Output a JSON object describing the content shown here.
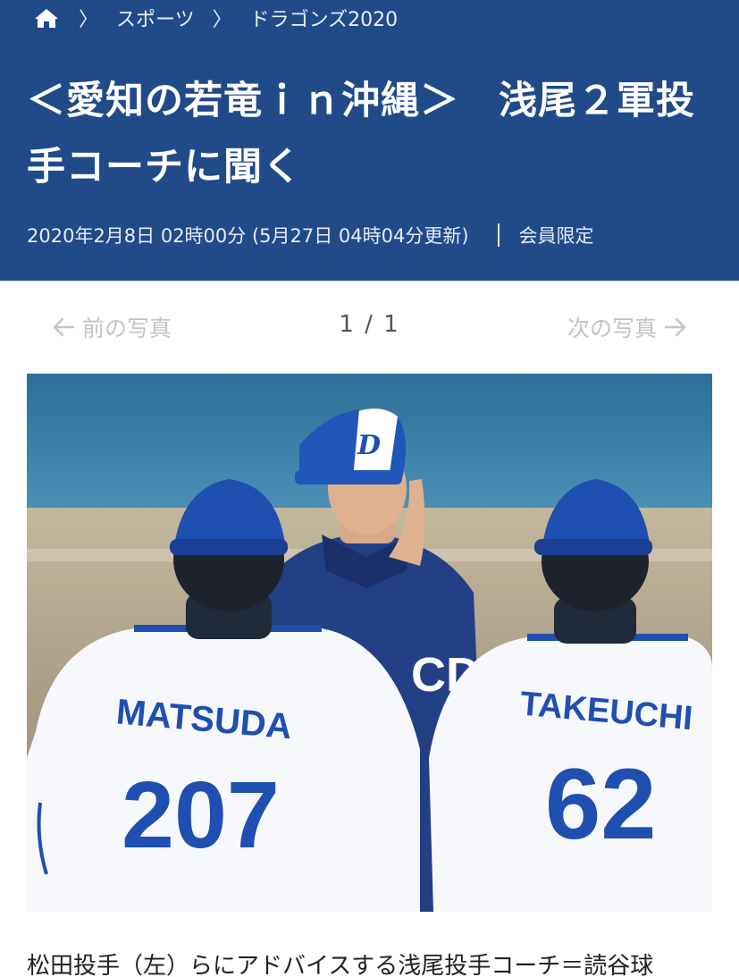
{
  "breadcrumb": {
    "home_icon": "home-icon",
    "separator": "〉",
    "items": [
      "スポーツ",
      "ドラゴンズ2020"
    ]
  },
  "article": {
    "title": "＜愛知の若竜ｉｎ沖縄＞　浅尾２軍投手コーチに聞く",
    "timestamp": "2020年2月8日 02時00分 (5月27日 04時04分更新)",
    "member_label": "会員限定"
  },
  "pager": {
    "prev_label": "前の写真",
    "next_label": "次の写真",
    "count": "1 / 1"
  },
  "photo": {
    "cap_logo": "D",
    "chest_logo": "CD",
    "player_left_name": "MATSUDA",
    "player_left_number": "207",
    "player_right_name": "TAKEUCHI",
    "player_right_number": "62"
  },
  "caption": "松田投手（左）らにアドバイスする浅尾投手コーチ＝読谷球",
  "colors": {
    "header_bg": "#214a88",
    "team_blue": "#1f4fb0",
    "pager_disabled": "#c4c4c4"
  }
}
